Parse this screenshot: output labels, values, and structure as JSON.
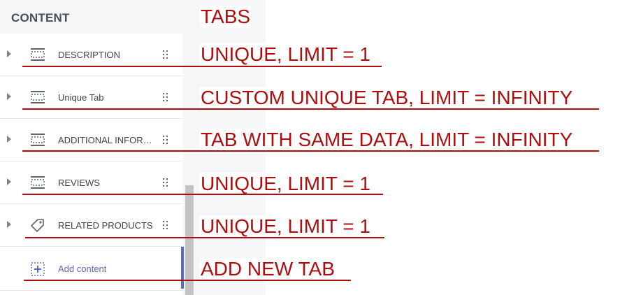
{
  "panel": {
    "title": "CONTENT",
    "rows": [
      {
        "label": "DESCRIPTION",
        "icon": "section-icon"
      },
      {
        "label": "Unique Tab",
        "icon": "section-icon"
      },
      {
        "label": "ADDITIONAL INFOR…",
        "icon": "section-icon"
      },
      {
        "label": "REVIEWS",
        "icon": "section-icon"
      },
      {
        "label": "RELATED PRODUCTS",
        "icon": "tag-icon"
      }
    ],
    "add": {
      "label": "Add content",
      "icon": "add-section-icon"
    }
  },
  "annotations": {
    "title": "TABS",
    "items": [
      "UNIQUE, LIMIT = 1",
      "CUSTOM UNIQUE TAB, LIMIT = INFINITY",
      "TAB WITH SAME DATA, LIMIT = INFINITY",
      "UNIQUE, LIMIT = 1",
      "UNIQUE, LIMIT = 1",
      "ADD NEW TAB"
    ]
  },
  "colors": {
    "annotation": "#ad0f0f",
    "accent": "#5c6ac4",
    "panel_header_bg": "#f4f6f8",
    "scroll_thumb": "#c4c4c4"
  }
}
